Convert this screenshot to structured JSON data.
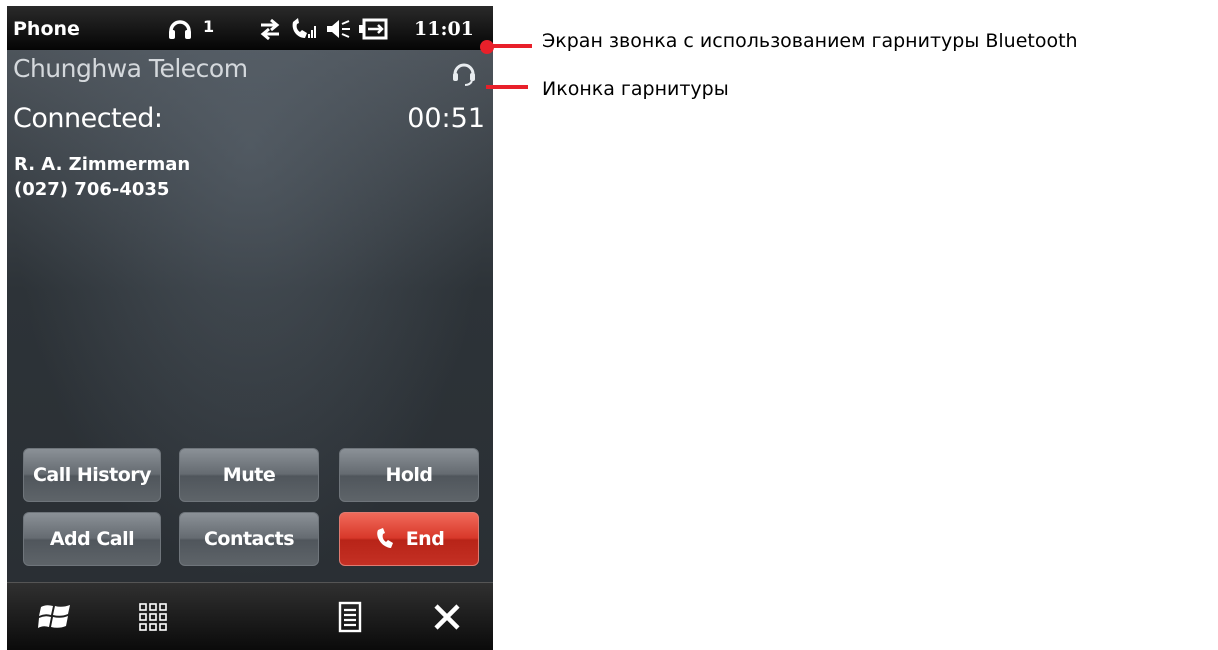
{
  "status_bar": {
    "app_title": "Phone",
    "indicator": "1",
    "time": "11:01",
    "icons": [
      "headset-icon",
      "data-transfer-icon",
      "signal-icon",
      "volume-icon",
      "battery-icon"
    ]
  },
  "call": {
    "carrier": "Chunghwa Telecom",
    "status": "Connected:",
    "timer": "00:51",
    "contact_name": "R. A. Zimmerman",
    "contact_number": "(027) 706-4035"
  },
  "buttons": {
    "call_history": "Call History",
    "mute": "Mute",
    "hold": "Hold",
    "add_call": "Add Call",
    "contacts": "Contacts",
    "end": "End"
  },
  "toolbar": {
    "icons": [
      "windows-start-icon",
      "keypad-icon",
      "menu-icon",
      "close-icon"
    ]
  },
  "annotations": {
    "bluetooth_screen": "Экран звонка с использованием гарнитуры Bluetooth",
    "headset_icon": "Иконка гарнитуры"
  },
  "colors": {
    "annotation": "#e8202a",
    "end_button": "#d8382a"
  }
}
